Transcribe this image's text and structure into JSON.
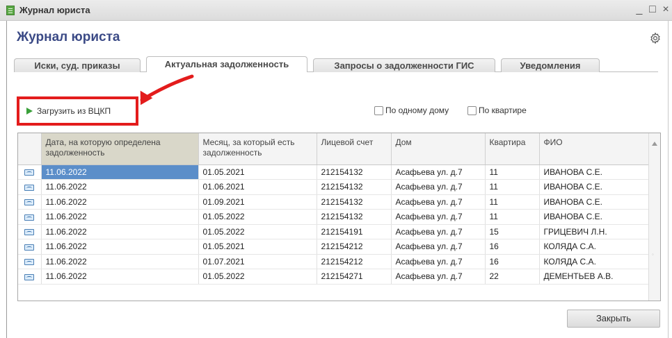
{
  "window": {
    "title": "Журнал юриста",
    "minimize": "_",
    "maximize": "□",
    "close": "×"
  },
  "heading": "Журнал юриста",
  "tabs": [
    {
      "label": "Иски, суд. приказы",
      "active": false
    },
    {
      "label": "Актуальная задолженность",
      "active": true
    },
    {
      "label": "Запросы о задолженности ГИС",
      "active": false
    },
    {
      "label": "Уведомления",
      "active": false
    }
  ],
  "toolbar": {
    "load_button": "Загрузить из ВЦКП",
    "checkbox_one_house": "По одному дому",
    "checkbox_one_apartment": "По квартире"
  },
  "annotation": {
    "highlight_color": "#e31c1c"
  },
  "table": {
    "columns": [
      "Дата, на которую определена задолженность",
      "Месяц, за который есть задолженность",
      "Лицевой счет",
      "Дом",
      "Квартира",
      "ФИО"
    ],
    "rows": [
      [
        "11.06.2022",
        "01.05.2021",
        "212154132",
        "Асафьева ул. д.7",
        "11",
        "ИВАНОВА С.Е."
      ],
      [
        "11.06.2022",
        "01.06.2021",
        "212154132",
        "Асафьева ул. д.7",
        "11",
        "ИВАНОВА С.Е."
      ],
      [
        "11.06.2022",
        "01.09.2021",
        "212154132",
        "Асафьева ул. д.7",
        "11",
        "ИВАНОВА С.Е."
      ],
      [
        "11.06.2022",
        "01.05.2022",
        "212154132",
        "Асафьева ул. д.7",
        "11",
        "ИВАНОВА С.Е."
      ],
      [
        "11.06.2022",
        "01.05.2022",
        "212154191",
        "Асафьева ул. д.7",
        "15",
        "ГРИЦЕВИЧ Л.Н."
      ],
      [
        "11.06.2022",
        "01.05.2021",
        "212154212",
        "Асафьева ул. д.7",
        "16",
        "КОЛЯДА С.А."
      ],
      [
        "11.06.2022",
        "01.07.2021",
        "212154212",
        "Асафьева ул. д.7",
        "16",
        "КОЛЯДА С.А."
      ],
      [
        "11.06.2022",
        "01.05.2022",
        "212154271",
        "Асафьева ул. д.7",
        "22",
        "ДЕМЕНТЬЕВ А.В."
      ]
    ]
  },
  "footer": {
    "close_button": "Закрыть"
  },
  "icons": {
    "app": "app-journal-icon",
    "settings": "gear-icon",
    "load": "play-icon",
    "row": "row-record-icon"
  }
}
